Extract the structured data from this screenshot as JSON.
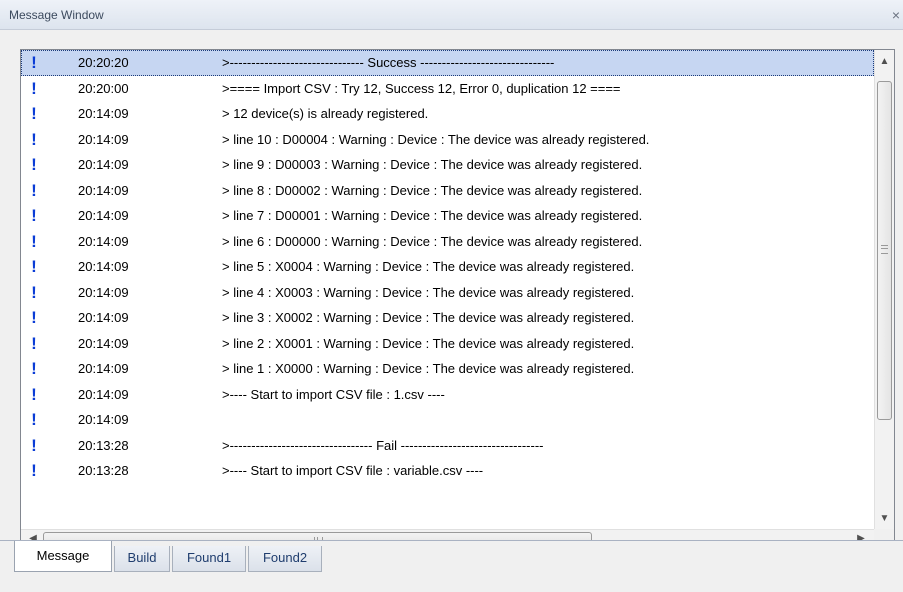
{
  "window": {
    "title": "Message Window",
    "close_glyph": "×"
  },
  "messages": [
    {
      "time": "20:20:20",
      "text": ">------------------------------- Success -------------------------------",
      "selected": true
    },
    {
      "time": "20:20:00",
      "text": ">==== Import CSV : Try 12, Success 12, Error 0, duplication 12 ===="
    },
    {
      "time": "20:14:09",
      "text": "> 12 device(s) is already registered."
    },
    {
      "time": "20:14:09",
      "text": "> line 10 : D00004 : Warning : Device : The device was already registered."
    },
    {
      "time": "20:14:09",
      "text": "> line 9 : D00003 : Warning : Device : The device was already registered."
    },
    {
      "time": "20:14:09",
      "text": "> line 8 : D00002 : Warning : Device : The device was already registered."
    },
    {
      "time": "20:14:09",
      "text": "> line 7 : D00001 : Warning : Device : The device was already registered."
    },
    {
      "time": "20:14:09",
      "text": "> line 6 : D00000 : Warning : Device : The device was already registered."
    },
    {
      "time": "20:14:09",
      "text": "> line 5 : X0004 : Warning : Device : The device was already registered."
    },
    {
      "time": "20:14:09",
      "text": "> line 4 : X0003 : Warning : Device : The device was already registered."
    },
    {
      "time": "20:14:09",
      "text": "> line 3 : X0002 : Warning : Device : The device was already registered."
    },
    {
      "time": "20:14:09",
      "text": "> line 2 : X0001 : Warning : Device : The device was already registered."
    },
    {
      "time": "20:14:09",
      "text": "> line 1 : X0000 : Warning : Device : The device was already registered."
    },
    {
      "time": "20:14:09",
      "text": ">---- Start to import CSV file : 1.csv ----"
    },
    {
      "time": "20:14:09",
      "text": ""
    },
    {
      "time": "20:13:28",
      "text": ">--------------------------------- Fail ---------------------------------"
    },
    {
      "time": "20:13:28",
      "text": ">---- Start to import CSV file : variable.csv ----"
    }
  ],
  "marker_glyph": "!",
  "scroll": {
    "up": "▲",
    "down": "▼",
    "left": "◀",
    "right": "▶"
  },
  "tabs": [
    {
      "label": "Message",
      "active": true
    },
    {
      "label": "Build"
    },
    {
      "label": "Found1"
    },
    {
      "label": "Found2"
    }
  ],
  "colors": {
    "marker": "#0a3cd6",
    "selection": "#c6d6f2",
    "tab_text": "#1f3d6e"
  }
}
